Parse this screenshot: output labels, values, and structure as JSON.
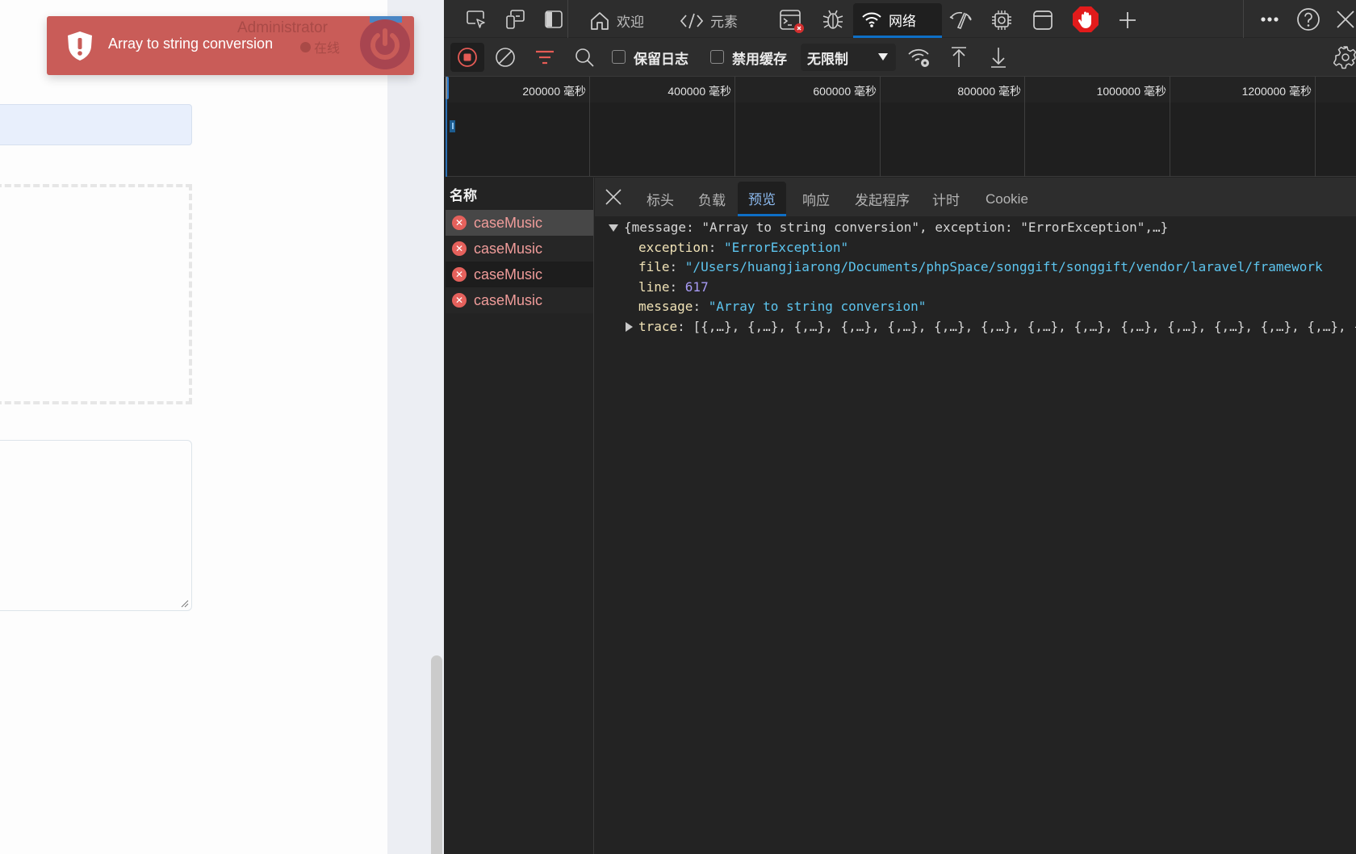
{
  "toast": {
    "message": "Array to string conversion",
    "user_name": "Administrator",
    "user_status": "在线",
    "shield_icon": "shield-exclamation-icon",
    "power_icon": "power-icon",
    "bg_color": "#c95c58"
  },
  "page": {
    "blue_field_value": "",
    "upload_area_label": "",
    "textarea_value": ""
  },
  "devtools": {
    "top_tabs": [
      {
        "icon": "inspect-icon"
      },
      {
        "icon": "device-emulation-icon"
      },
      {
        "icon": "dock-side-icon"
      },
      {
        "icon": "home-icon",
        "label": "欢迎"
      },
      {
        "icon": "code-icon",
        "label": "元素"
      },
      {
        "icon": "console-icon",
        "badge": "error"
      },
      {
        "icon": "bug-icon"
      },
      {
        "icon": "wifi-icon",
        "label": "网络",
        "active": true
      },
      {
        "icon": "performance-icon"
      },
      {
        "icon": "chip-icon"
      },
      {
        "icon": "application-icon"
      },
      {
        "icon": "adblock-stop-icon"
      },
      {
        "icon": "plus-icon"
      }
    ],
    "toolbar": {
      "preserve_log_label": "保留日志",
      "preserve_log_checked": false,
      "disable_cache_label": "禁用缓存",
      "disable_cache_checked": false,
      "throttle_value": "无限制"
    },
    "timeline": {
      "ticks": [
        "200000 毫秒",
        "400000 毫秒",
        "600000 毫秒",
        "800000 毫秒",
        "1000000 毫秒",
        "1200000 毫秒"
      ]
    },
    "requests": {
      "header": "名称",
      "items": [
        {
          "name": "caseMusic",
          "status": "error",
          "selected": true
        },
        {
          "name": "caseMusic",
          "status": "error",
          "selected": false
        },
        {
          "name": "caseMusic",
          "status": "error",
          "selected": false
        },
        {
          "name": "caseMusic",
          "status": "error",
          "selected": false
        }
      ]
    },
    "details": {
      "tabs": [
        "标头",
        "负载",
        "预览",
        "响应",
        "发起程序",
        "计时",
        "Cookie"
      ],
      "active_tab": "预览",
      "preview": {
        "summary": "{message: \"Array to string conversion\", exception: \"ErrorException\",…}",
        "props": [
          {
            "key": "exception",
            "value": "\"ErrorException\"",
            "type": "string"
          },
          {
            "key": "file",
            "value": "\"/Users/huangjiarong/Documents/phpSpace/songgift/songgift/vendor/laravel/framework",
            "type": "string"
          },
          {
            "key": "line",
            "value": "617",
            "type": "number"
          },
          {
            "key": "message",
            "value": "\"Array to string conversion\"",
            "type": "string"
          },
          {
            "key": "trace",
            "value": "[{,…}, {,…}, {,…}, {,…}, {,…}, {,…}, {,…}, {,…}, {,…}, {,…}, {,…}, {,…}, {,…}, {,…}, {,",
            "type": "collapsed"
          }
        ]
      }
    }
  }
}
